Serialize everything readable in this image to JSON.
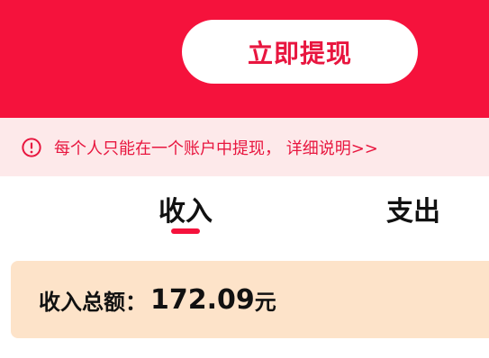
{
  "header": {
    "withdraw_button_label": "立即提现"
  },
  "notice": {
    "text": "每个人只能在一个账户中提现， 详细说明>>"
  },
  "tabs": [
    {
      "label": "收入",
      "active": true
    },
    {
      "label": "支出",
      "active": false
    }
  ],
  "summary": {
    "label": "收入总额：",
    "amount": "172.09",
    "unit": "元"
  },
  "colors": {
    "accent": "#f5123c",
    "notice_bg": "#fde9ea",
    "card_bg": "#fde3c9"
  },
  "icons": {
    "notice": "alert-circle-icon"
  }
}
